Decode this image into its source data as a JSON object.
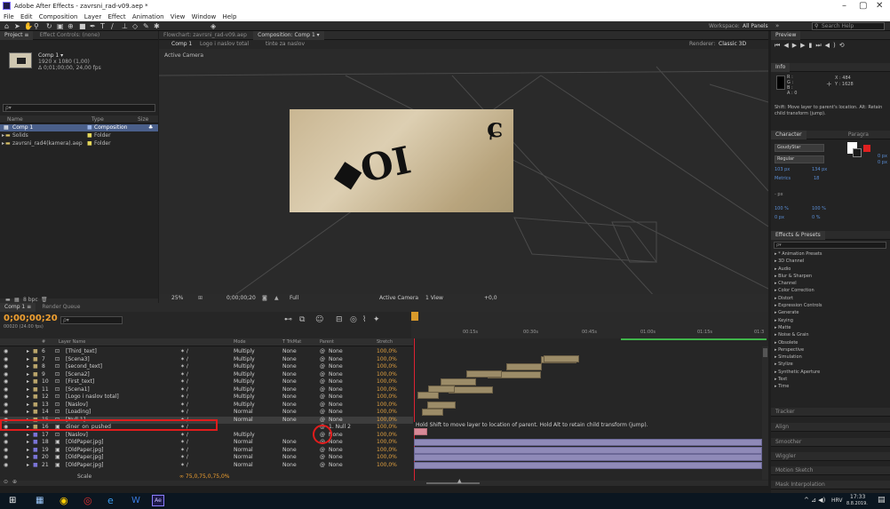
{
  "window": {
    "title": "Adobe After Effects - zavrsni_rad-v09.aep *",
    "min": "–",
    "max": "▢",
    "close": "✕"
  },
  "menu": [
    "File",
    "Edit",
    "Composition",
    "Layer",
    "Effect",
    "Animation",
    "View",
    "Window",
    "Help"
  ],
  "toolbar": {
    "workspace_label": "Workspace:",
    "workspace_value": "All Panels",
    "search_placeholder": "Search Help"
  },
  "project": {
    "tabs": [
      "Project ≡",
      "Effect Controls: (none)"
    ],
    "thumb_name": "Comp 1 ▾",
    "thumb_info1": "1920 x 1080 (1,00)",
    "thumb_info2": "Δ 0;01;00;00, 24,00 fps",
    "search_placeholder": "ρ▾",
    "col_name": "Name",
    "col_type": "Type",
    "col_size": "Size",
    "items": [
      {
        "name": "Comp 1",
        "type": "Composition"
      },
      {
        "name": "Solids",
        "type": "Folder"
      },
      {
        "name": "zavrsni_rad4(kamera).aep",
        "type": "Folder"
      }
    ],
    "footer_bpc": "8 bpc"
  },
  "viewer": {
    "tabs": [
      "Flowchart: zavrsni_rad-v09.aep",
      "Composition: Comp 1 ▾"
    ],
    "breadcrumbs": [
      "Comp 1",
      "Logo i naslov total",
      "tinte za naslov"
    ],
    "renderer_label": "Renderer:",
    "renderer_value": "Classic 3D",
    "camera_label": "Active Camera",
    "footer": {
      "zoom": "25%",
      "time": "0;00;00;20",
      "res": "Full",
      "camera": "Active Camera",
      "views": "1 View",
      "exposure": "+0,0"
    }
  },
  "timeline": {
    "tabs": [
      "Comp 1 ≡",
      "Render Queue"
    ],
    "timecode": "0;00;00;20",
    "frames": "00020 (24.00 fps)",
    "search_placeholder": "ρ▾",
    "header_cols": [
      "#",
      "Layer Name",
      "Mode",
      "T TrkMat",
      "Parent",
      "Stretch"
    ],
    "ruler": [
      "00:15s",
      "00:30s",
      "00:45s",
      "01:00s",
      "01:15s",
      "01:3"
    ],
    "layers": [
      {
        "num": "6",
        "name": "[Third_text]",
        "mode": "Multiply",
        "trk": "None",
        "parent": "None",
        "stretch": "100,0%"
      },
      {
        "num": "7",
        "name": "[Scena3]",
        "mode": "Multiply",
        "trk": "None",
        "parent": "None",
        "stretch": "100,0%"
      },
      {
        "num": "8",
        "name": "[second_text]",
        "mode": "Multiply",
        "trk": "None",
        "parent": "None",
        "stretch": "100,0%"
      },
      {
        "num": "9",
        "name": "[Scena2]",
        "mode": "Multiply",
        "trk": "None",
        "parent": "None",
        "stretch": "100,0%"
      },
      {
        "num": "10",
        "name": "[First_text]",
        "mode": "Multiply",
        "trk": "None",
        "parent": "None",
        "stretch": "100,0%"
      },
      {
        "num": "11",
        "name": "[Scena1]",
        "mode": "Multiply",
        "trk": "None",
        "parent": "None",
        "stretch": "100,0%"
      },
      {
        "num": "12",
        "name": "[Logo i naslov total]",
        "mode": "Multiply",
        "trk": "None",
        "parent": "None",
        "stretch": "100,0%"
      },
      {
        "num": "13",
        "name": "[Naslov]",
        "mode": "Multiply",
        "trk": "None",
        "parent": "None",
        "stretch": "100,0%"
      },
      {
        "num": "14",
        "name": "[Loading]",
        "mode": "Normal",
        "trk": "None",
        "parent": "None",
        "stretch": "100,0%"
      },
      {
        "num": "15",
        "name": "[Null 1]",
        "mode": "Normal",
        "trk": "None",
        "parent": "None",
        "stretch": "100,0%"
      },
      {
        "num": "16",
        "name": "diner_on_pushed",
        "mode": "",
        "trk": "",
        "parent": "1. Null 2",
        "stretch": "100,0%"
      },
      {
        "num": "17",
        "name": "[Naslov]",
        "mode": "Multiply",
        "trk": "",
        "parent": "None",
        "stretch": "100,0%"
      },
      {
        "num": "18",
        "name": "[OldPaper.jpg]",
        "mode": "Normal",
        "trk": "None",
        "parent": "None",
        "stretch": "100,0%"
      },
      {
        "num": "19",
        "name": "[OldPaper.jpg]",
        "mode": "Normal",
        "trk": "None",
        "parent": "None",
        "stretch": "100,0%"
      },
      {
        "num": "20",
        "name": "[OldPaper.jpg]",
        "mode": "Normal",
        "trk": "None",
        "parent": "None",
        "stretch": "100,0%"
      },
      {
        "num": "21",
        "name": "[OldPaper.jpg]",
        "mode": "Normal",
        "trk": "None",
        "parent": "None",
        "stretch": "100,0%"
      }
    ],
    "scale_label": "Scale",
    "scale_value": "∞ 75,0,75,0,75,0%",
    "tooltip": "Hold Shift to move layer to location of parent. Hold Alt to retain child transform (jump)."
  },
  "right": {
    "preview_tab": "Preview",
    "info_tab": "Info",
    "info_x": "X : 484",
    "info_y": "Y : 1628",
    "info_r": "R :",
    "info_g": "G :",
    "info_b": "B :",
    "info_a": "A : 0",
    "info_hint": "Shift: Move layer to parent's location. Alt: Retain child transform (jump).",
    "character_tab": "Character",
    "paragraph_tab": "Paragra",
    "font": "GoudyStar",
    "style": "Regular",
    "size": "103 px",
    "leading": "134 px",
    "metrics": "Metrics",
    "tracking": "18",
    "stroke": "- px",
    "vscale": "100 %",
    "hscale": "100 %",
    "baseline": "0 px",
    "tsume": "0 %",
    "para_vals": [
      "0 px",
      "0 px"
    ],
    "effects_tab": "Effects & Presets",
    "effects_search": "ρ▾",
    "effects": [
      "* Animation Presets",
      "3D Channel",
      "Audio",
      "Blur & Sharpen",
      "Channel",
      "Color Correction",
      "Distort",
      "Expression Controls",
      "Generate",
      "Keying",
      "Matte",
      "Noise & Grain",
      "Obsolete",
      "Perspective",
      "Simulation",
      "Stylize",
      "Synthetic Aperture",
      "Text",
      "Time"
    ],
    "tracker_tab": "Tracker",
    "align_tab": "Align",
    "smoother_tab": "Smoother",
    "wiggler_tab": "Wiggler",
    "motion_sketch_tab": "Motion Sketch",
    "mask_interp_tab": "Mask Interpolation"
  },
  "taskbar": {
    "lang": "HRV",
    "time": "17:33",
    "date": "8.8.2019."
  }
}
